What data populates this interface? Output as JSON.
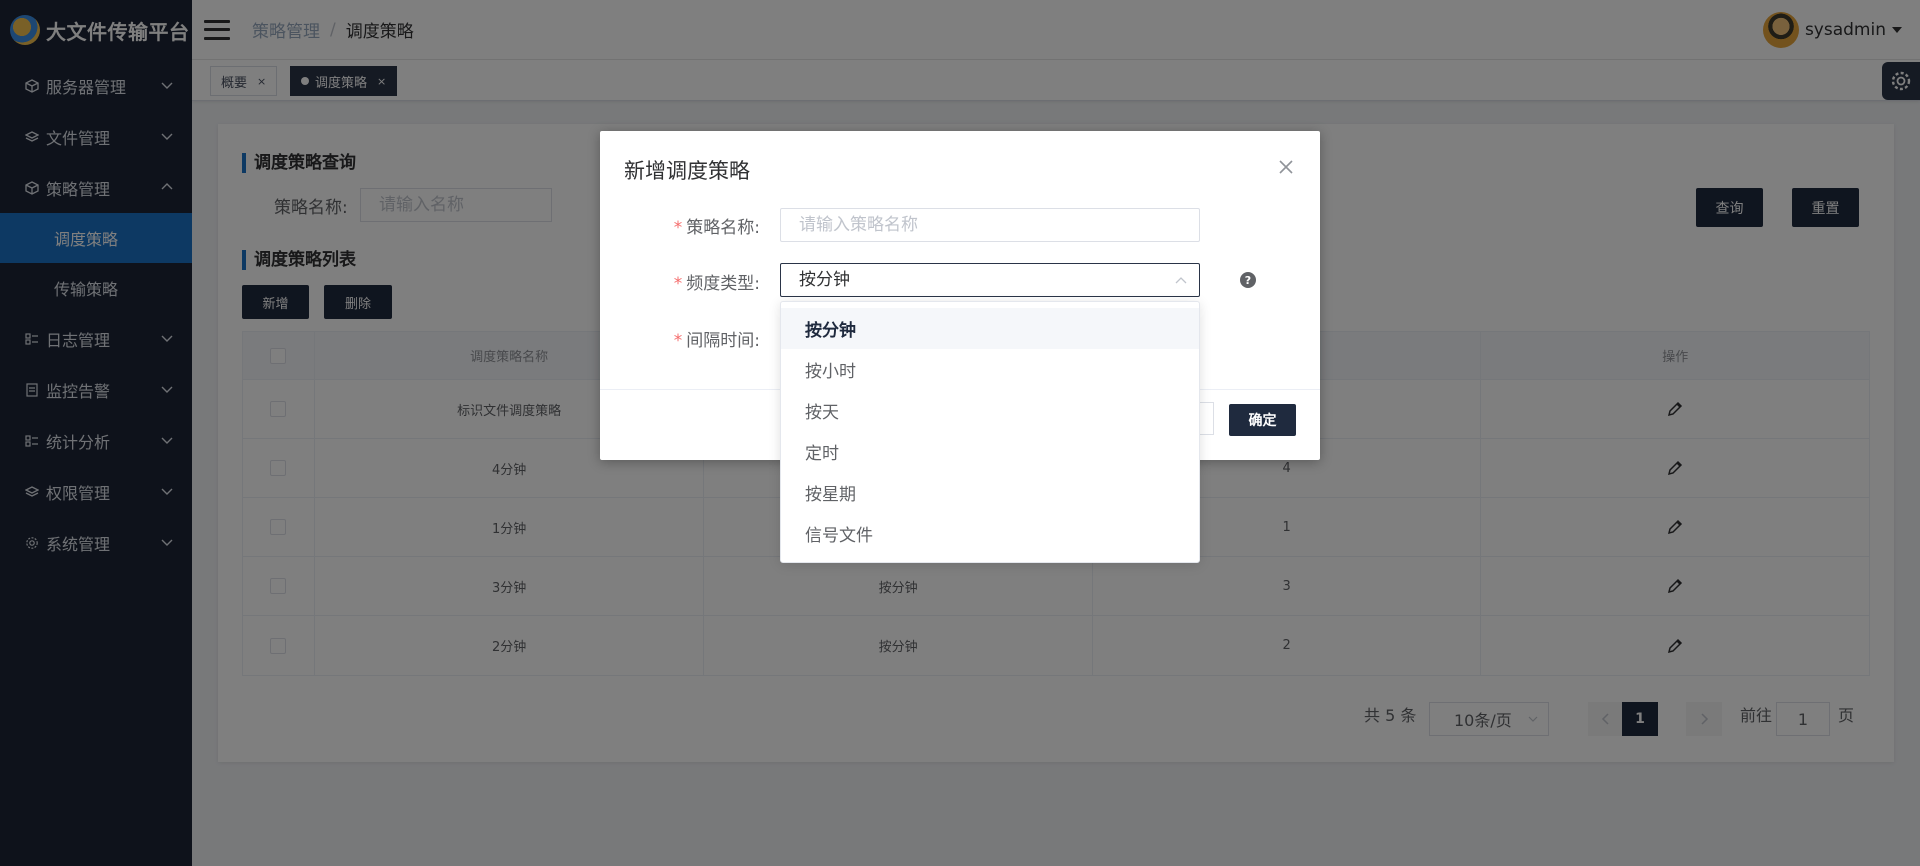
{
  "app": {
    "title": "大文件传输平台"
  },
  "sidebar": {
    "items": [
      {
        "label": "服务器管理",
        "icon": "cube-icon"
      },
      {
        "label": "文件管理",
        "icon": "layers-icon"
      },
      {
        "label": "策略管理",
        "icon": "cube-icon",
        "expanded": true,
        "children": [
          {
            "label": "调度策略",
            "active": true
          },
          {
            "label": "传输策略"
          }
        ]
      },
      {
        "label": "日志管理",
        "icon": "list-icon"
      },
      {
        "label": "监控告警",
        "icon": "monitor-icon"
      },
      {
        "label": "统计分析",
        "icon": "list-icon"
      },
      {
        "label": "权限管理",
        "icon": "layers-icon"
      },
      {
        "label": "系统管理",
        "icon": "gear-icon"
      }
    ]
  },
  "header": {
    "breadcrumb": [
      "策略管理",
      "调度策略"
    ],
    "separator": "/",
    "user": "sysadmin"
  },
  "tags": [
    {
      "label": "概要",
      "active": false
    },
    {
      "label": "调度策略",
      "active": true
    }
  ],
  "query": {
    "title": "调度策略查询",
    "name_label": "策略名称:",
    "name_placeholder": "请输入名称",
    "search_label": "查询",
    "reset_label": "重置"
  },
  "list": {
    "title": "调度策略列表",
    "add_label": "新增",
    "delete_label": "删除",
    "columns": [
      "调度策略名称",
      "",
      "",
      "操作"
    ],
    "rows": [
      {
        "name": "标识文件调度策略",
        "type": "",
        "interval": ""
      },
      {
        "name": "4分钟",
        "type": "",
        "interval": "4"
      },
      {
        "name": "1分钟",
        "type": "",
        "interval": "1"
      },
      {
        "name": "3分钟",
        "type": "按分钟",
        "interval": "3"
      },
      {
        "name": "2分钟",
        "type": "按分钟",
        "interval": "2"
      }
    ]
  },
  "pagination": {
    "total": "共 5 条",
    "page_size": "10条/页",
    "current": "1",
    "goto_label": "前往",
    "goto_value": "1",
    "page_suffix": "页"
  },
  "modal": {
    "title": "新增调度策略",
    "name_label": "策略名称:",
    "name_placeholder": "请输入策略名称",
    "freq_label": "频度类型:",
    "freq_value": "按分钟",
    "interval_label": "间隔时间:",
    "ok_label": "确定",
    "required_mark": "*",
    "help_mark": "?"
  },
  "dropdown": {
    "options": [
      "按分钟",
      "按小时",
      "按天",
      "定时",
      "按星期",
      "信号文件"
    ],
    "selected": "按分钟"
  },
  "colors": {
    "sidebar_bg": "#1c2536",
    "active": "#1a73c7",
    "primary_btn": "#1f2a3e"
  }
}
